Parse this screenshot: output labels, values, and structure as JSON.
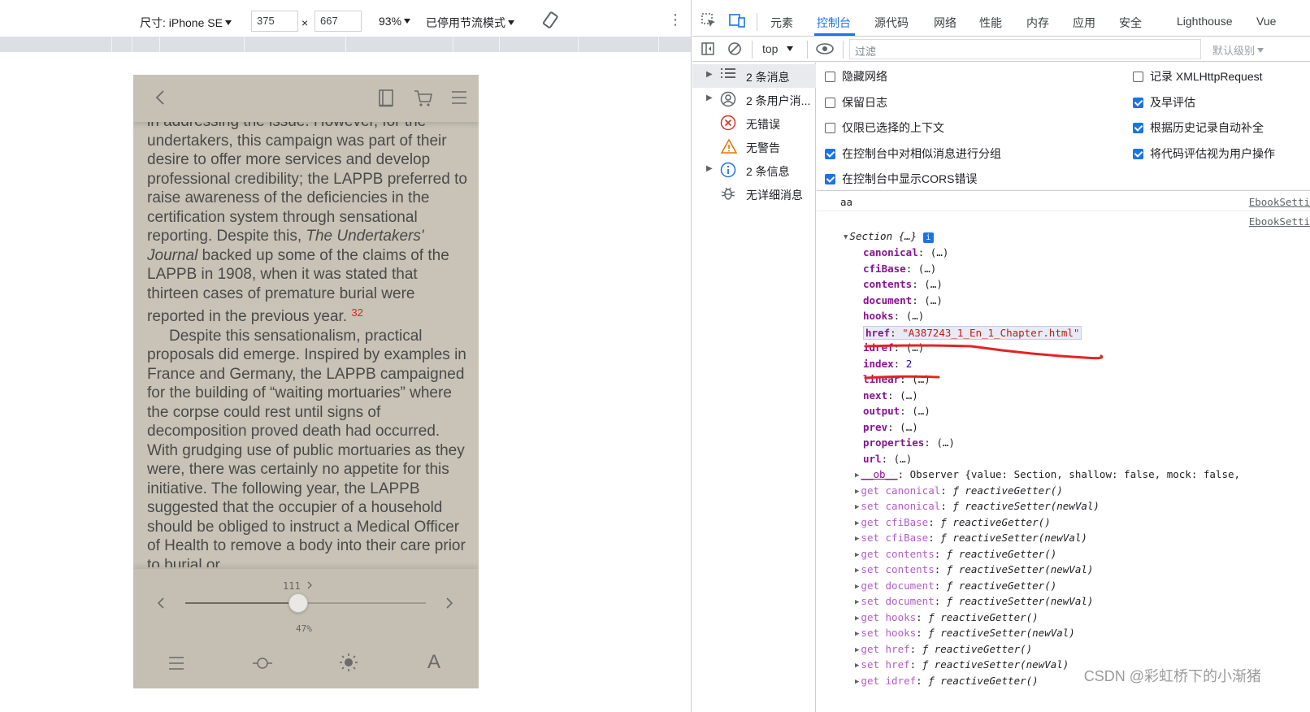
{
  "emulation_toolbar": {
    "device_label": "尺寸: iPhone SE",
    "width": "375",
    "times": "×",
    "height": "667",
    "zoom": "93%",
    "throttle": "已停用节流模式"
  },
  "phone": {
    "paragraphs": [
      "in addressing the issue. However, for the undertakers, this campaign was part of their desire to offer more services and develop professional credibility; the LAPPB preferred to raise awareness of the deficiencies in the certification system through sensational reporting. Despite this,",
      "The Undertakers' Journal",
      "backed up some of the claims of the LAPPB in 1908, when it was stated that thirteen cases of premature burial were reported in the previous year.",
      "32",
      "Despite this sensationalism, practical proposals did emerge. Inspired by examples in France and Germany, the LAPPB campaigned for the building of “waiting mortuaries” where the corpse could rest until signs of decomposition proved death had occurred. With grudging use of public mortuaries as they were, there was certainly no appetite for this initiative. The following year, the LAPPB suggested that the occupier of a household should be obliged to instruct a Medical Officer of Health to remove a body into their care prior to burial or"
    ],
    "page_number": "111",
    "progress_label": "47%",
    "progress_value": 0.47
  },
  "devtools": {
    "tabs": [
      "元素",
      "控制台",
      "源代码",
      "网络",
      "性能",
      "内存",
      "应用",
      "安全",
      "Lighthouse",
      "Vue"
    ],
    "active_tab": "控制台",
    "context": "top",
    "filter_placeholder": "过滤",
    "level": "默认级别",
    "sidebar": [
      {
        "label": "2 条消息",
        "icon": "list-icon",
        "selected": true,
        "expandable": true
      },
      {
        "label": "2 条用户消...",
        "icon": "user-icon",
        "selected": false,
        "expandable": true
      },
      {
        "label": "无错误",
        "icon": "error-icon",
        "selected": false,
        "expandable": false
      },
      {
        "label": "无警告",
        "icon": "warning-icon",
        "selected": false,
        "expandable": false
      },
      {
        "label": "2 条信息",
        "icon": "info-icon",
        "selected": false,
        "expandable": true
      },
      {
        "label": "无详细消息",
        "icon": "bug-icon",
        "selected": false,
        "expandable": false
      }
    ],
    "settings_left": [
      {
        "label": "隐藏网络",
        "checked": false
      },
      {
        "label": "保留日志",
        "checked": false
      },
      {
        "label": "仅限已选择的上下文",
        "checked": false
      },
      {
        "label": "在控制台中对相似消息进行分组",
        "checked": true
      },
      {
        "label": "在控制台中显示CORS错误",
        "checked": true
      }
    ],
    "settings_right": [
      {
        "label": "记录 XMLHttpRequest",
        "checked": false
      },
      {
        "label": "及早评估",
        "checked": true
      },
      {
        "label": "根据历史记录自动补全",
        "checked": true
      },
      {
        "label": "将代码评估视为用户操作",
        "checked": true
      }
    ],
    "messages": [
      {
        "text": "aa",
        "source": "EbookSetti"
      },
      {
        "text": "",
        "source": "EbookSetti"
      }
    ],
    "object_header": "Section {…}",
    "props": [
      {
        "key": "canonical",
        "value": "(…)"
      },
      {
        "key": "cfiBase",
        "value": "(…)"
      },
      {
        "key": "contents",
        "value": "(…)"
      },
      {
        "key": "document",
        "value": "(…)"
      },
      {
        "key": "hooks",
        "value": "(…)"
      },
      {
        "key": "href",
        "value": "\"A387243_1_En_1_Chapter.html\""
      },
      {
        "key": "idref",
        "value": "(…)"
      },
      {
        "key": "index",
        "value": "2"
      },
      {
        "key": "linear",
        "value": "(…)"
      },
      {
        "key": "next",
        "value": "(…)"
      },
      {
        "key": "output",
        "value": "(…)"
      },
      {
        "key": "prev",
        "value": "(…)"
      },
      {
        "key": "properties",
        "value": "(…)"
      },
      {
        "key": "url",
        "value": "(…)"
      }
    ],
    "ob_line": {
      "key": "__ob__",
      "value": "Observer {value: Section, shallow: false, mock: false,"
    },
    "accessors": [
      {
        "kind": "get",
        "name": "canonical",
        "fn": "reactiveGetter()"
      },
      {
        "kind": "set",
        "name": "canonical",
        "fn": "reactiveSetter(newVal)"
      },
      {
        "kind": "get",
        "name": "cfiBase",
        "fn": "reactiveGetter()"
      },
      {
        "kind": "set",
        "name": "cfiBase",
        "fn": "reactiveSetter(newVal)"
      },
      {
        "kind": "get",
        "name": "contents",
        "fn": "reactiveGetter()"
      },
      {
        "kind": "set",
        "name": "contents",
        "fn": "reactiveSetter(newVal)"
      },
      {
        "kind": "get",
        "name": "document",
        "fn": "reactiveGetter()"
      },
      {
        "kind": "set",
        "name": "document",
        "fn": "reactiveSetter(newVal)"
      },
      {
        "kind": "get",
        "name": "hooks",
        "fn": "reactiveGetter()"
      },
      {
        "kind": "set",
        "name": "hooks",
        "fn": "reactiveSetter(newVal)"
      },
      {
        "kind": "get",
        "name": "href",
        "fn": "reactiveGetter()"
      },
      {
        "kind": "set",
        "name": "href",
        "fn": "reactiveSetter(newVal)"
      },
      {
        "kind": "get",
        "name": "idref",
        "fn": "reactiveGetter()"
      }
    ],
    "watermark": "CSDN @彩虹桥下的小渐猪"
  }
}
